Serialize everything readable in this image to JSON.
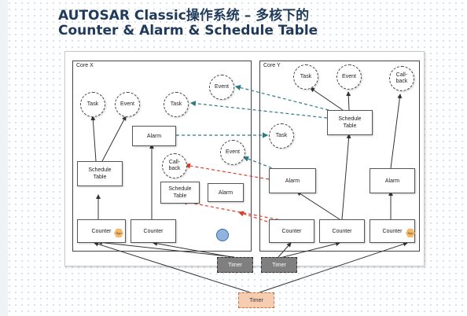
{
  "title": {
    "line1": "AUTOSAR Classic操作系统 – 多核下的",
    "line2": "Counter & Alarm & Schedule Table"
  },
  "core_x": {
    "label": "Core X",
    "task": "Task",
    "event": "Event",
    "task2": "Task",
    "schedule_table": "Schedule\nTable",
    "alarm": "Alarm",
    "callback": "Call-\nback",
    "schedule_table2": "Schedule\nTable",
    "alarm2": "Alarm",
    "counter1": "Counter",
    "counter1_badge": "Syn",
    "counter2": "Counter"
  },
  "core_y": {
    "label": "Core Y",
    "task1": "Task",
    "event1": "Event",
    "callback": "Call-\nback",
    "schedule_table": "Schedule\nTable",
    "alarm1": "Alarm",
    "alarm2": "Alarm",
    "counter1": "Counter",
    "counter2": "Counter",
    "counter3": "Counter",
    "counter3_badge": "Syn"
  },
  "between": {
    "event_top": "Event",
    "task_mid": "Task",
    "event_mid": "Event"
  },
  "timers": {
    "timer_x": "Timer",
    "timer_y": "Timer",
    "timer_main": "Timer"
  },
  "colors": {
    "cross_core_activation": "#2e7b88",
    "cross_core_callback": "#e03c2a",
    "os_timer": "#7f7f7f",
    "global_timer": "#f7cdb2",
    "sync_badge": "#f5b96a"
  }
}
